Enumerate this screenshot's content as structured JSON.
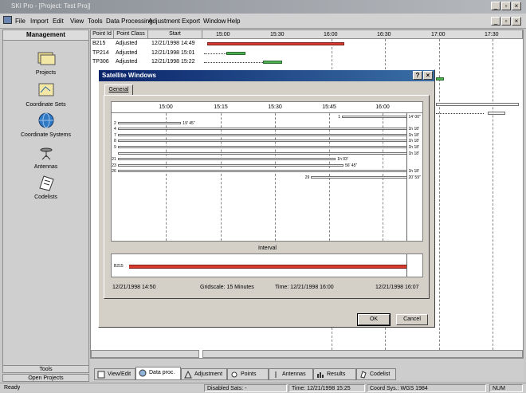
{
  "window": {
    "title": "SKI Pro - [Project: Test Proj]"
  },
  "menu": [
    "File",
    "Import",
    "Edit",
    "View",
    "Tools",
    "Data Processing",
    "Adjustment",
    "Export",
    "Window",
    "Help"
  ],
  "sidebar": {
    "header": "Management",
    "items": [
      {
        "label": "Projects",
        "icon": "projects-icon"
      },
      {
        "label": "Coordinate Sets",
        "icon": "coordinate-sets-icon"
      },
      {
        "label": "Coordinate Systems",
        "icon": "globe-icon"
      },
      {
        "label": "Antennas",
        "icon": "antenna-icon"
      },
      {
        "label": "Codelists",
        "icon": "codelist-icon"
      }
    ],
    "footer": [
      "Tools",
      "Open Projects"
    ]
  },
  "table": {
    "headers": [
      "Point Id",
      "Point Class",
      "Start"
    ],
    "timeline_labels": [
      "15:00",
      "15:30",
      "16:00",
      "16:30",
      "17:00",
      "17:30"
    ],
    "rows": [
      {
        "id": "B215",
        "cls": "Adjusted",
        "start": "12/21/1998 14:49"
      },
      {
        "id": "TP214",
        "cls": "Adjusted",
        "start": "12/21/1998 15:01"
      },
      {
        "id": "TP306",
        "cls": "Adjusted",
        "start": "12/21/1998 15:22"
      }
    ]
  },
  "dialog": {
    "title": "Satellite Windows",
    "tab": "General",
    "ticks": [
      "15:00",
      "15:15",
      "15:30",
      "15:45",
      "16:00"
    ],
    "satellites": [
      {
        "num": "1",
        "start": 0.745,
        "end": 0.955,
        "dur": "14' 00\""
      },
      {
        "num": "2",
        "start": 0.02,
        "end": 0.225,
        "dur": "19' 45\""
      },
      {
        "num": "4",
        "start": 0.02,
        "end": 0.955,
        "dur": "1h 18'"
      },
      {
        "num": "7",
        "start": 0.02,
        "end": 0.955,
        "dur": "1h 18'"
      },
      {
        "num": "8",
        "start": 0.02,
        "end": 0.955,
        "dur": "1h 18'"
      },
      {
        "num": "9",
        "start": 0.02,
        "end": 0.955,
        "dur": "1h 18'"
      },
      {
        "num": "",
        "start": 0.02,
        "end": 0.955,
        "dur": "1h 18'"
      },
      {
        "num": "21",
        "start": 0.02,
        "end": 0.725,
        "dur": "1h 03'"
      },
      {
        "num": "23",
        "start": 0.02,
        "end": 0.75,
        "dur": "56' 45\""
      },
      {
        "num": "26",
        "start": 0.02,
        "end": 0.955,
        "dur": "1h 18'"
      },
      {
        "num": "29",
        "start": 0.645,
        "end": 0.955,
        "dur": "20' 59\""
      }
    ],
    "interval_label": "Interval",
    "interval_point": "B215",
    "info": {
      "start": "12/21/1998 14:50",
      "gridscale": "Gridscale: 15 Minutes",
      "time": "Time: 12/21/1998 16:00",
      "end": "12/21/1998 16:07"
    },
    "ok": "OK",
    "cancel": "Cancel"
  },
  "tabs": [
    "View/Edit",
    "Data proc.",
    "Adjustment",
    "Points",
    "Antennas",
    "Results",
    "Codelist"
  ],
  "status": {
    "ready": "Ready",
    "disabled": "Disabled Sats: -",
    "time": "Time: 12/21/1998 15:25",
    "coord": "Coord Sys.: WGS 1984",
    "num": "NUM"
  },
  "colors": {
    "title_active": "#0a246a",
    "interval_bar": "#d83a2e",
    "green_bar": "#4caf50"
  }
}
